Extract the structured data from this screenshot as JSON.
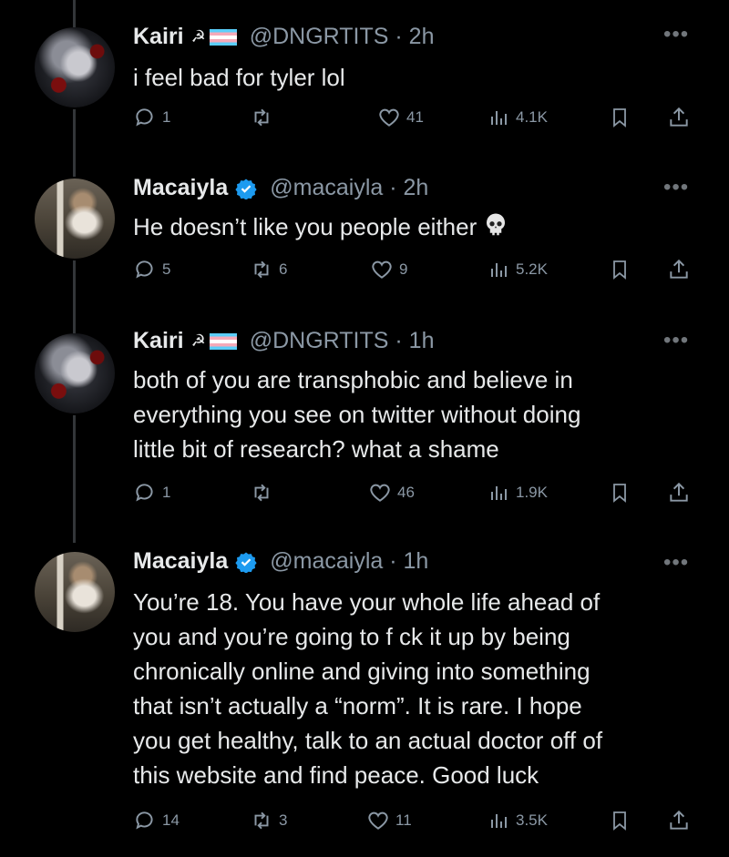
{
  "tweets": [
    {
      "author": "Kairi",
      "author_badges": [
        "hammer-sickle-icon",
        "trans-flag-icon"
      ],
      "handle": "@DNGRTITS",
      "time": "2h",
      "text": "i feel bad for tyler lol",
      "replies": "1",
      "reposts": "",
      "likes": "41",
      "views": "4.1K"
    },
    {
      "author": "Macaiyla",
      "author_badges": [
        "verified-icon"
      ],
      "handle": "@macaiyla",
      "time": "2h",
      "text": "He doesn’t like you people either",
      "text_emoji": "skull-icon",
      "replies": "5",
      "reposts": "6",
      "likes": "9",
      "views": "5.2K"
    },
    {
      "author": "Kairi",
      "author_badges": [
        "hammer-sickle-icon",
        "trans-flag-icon"
      ],
      "handle": "@DNGRTITS",
      "time": "1h",
      "text_lines": [
        "both of you are transphobic and believe in",
        "everything you see on twitter without doing",
        "little bit of research? what a shame"
      ],
      "replies": "1",
      "reposts": "",
      "likes": "46",
      "views": "1.9K"
    },
    {
      "author": "Macaiyla",
      "author_badges": [
        "verified-icon"
      ],
      "handle": "@macaiyla",
      "time": "1h",
      "text_lines": [
        "You’re 18. You have your whole life ahead of",
        "you and you’re going to f  ck it up by being",
        "chronically online and giving into something",
        "that isn’t actually a “norm”. It is rare. I hope",
        "you get healthy, talk to an actual doctor off of",
        "this website and find peace. Good luck"
      ],
      "replies": "14",
      "reposts": "3",
      "likes": "11",
      "views": "3.5K"
    }
  ],
  "separator": "·",
  "more_icon": "more-dots-icon",
  "colors": {
    "background": "#000000",
    "text": "#e7e9ea",
    "secondary": "#71767b",
    "verified": "#1d9bf0",
    "thread_line": "#333639"
  }
}
